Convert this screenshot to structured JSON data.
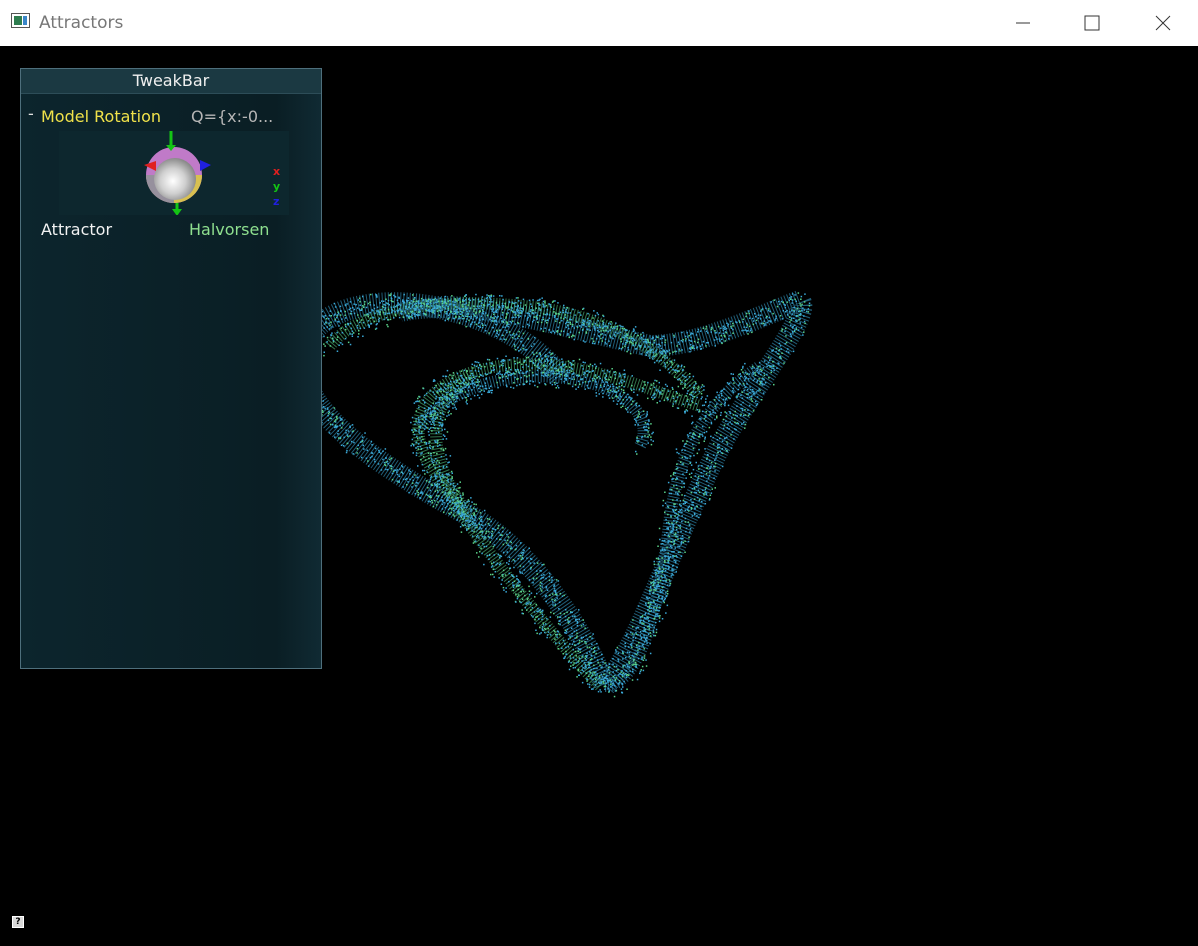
{
  "window": {
    "title": "Attractors",
    "icon": "app-window-icon",
    "controls": [
      "minimize-icon",
      "maximize-icon",
      "close-icon"
    ]
  },
  "tweakbar": {
    "title": "TweakBar",
    "collapse_symbol": "-",
    "model_rotation": {
      "label": "Model Rotation",
      "value": "Q={x:-0...",
      "axes": [
        "x",
        "y",
        "z"
      ]
    },
    "attractor": {
      "label": "Attractor",
      "value": "Halvorsen"
    }
  },
  "help_icon_glyph": "?",
  "colors": {
    "background": "#000000",
    "panel": "#0b2026",
    "group_label": "#f0e24a",
    "attractor_value": "#8fe08f",
    "points_primary": "#3aa9d8",
    "points_secondary": "#5ad38a"
  }
}
